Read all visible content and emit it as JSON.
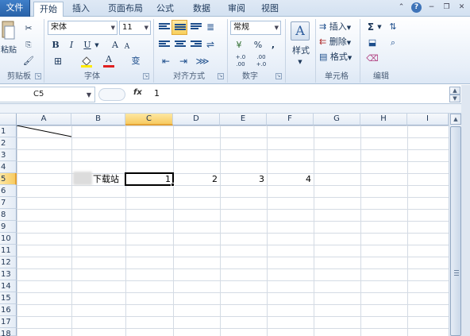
{
  "tabs": [
    "文件",
    "开始",
    "插入",
    "页面布局",
    "公式",
    "数据",
    "审阅",
    "视图"
  ],
  "active_tab": "开始",
  "clipboard": {
    "paste_label": "粘贴",
    "group_label": "剪贴板"
  },
  "font": {
    "font_name": "宋体",
    "font_size": "11",
    "group_label": "字体",
    "bold": "B",
    "italic": "I",
    "underline": "U",
    "grow": "A",
    "shrink": "A",
    "phonetic": "变"
  },
  "alignment": {
    "group_label": "对齐方式"
  },
  "number": {
    "format": "常规",
    "group_label": "数字",
    "currency": "¥",
    "percent": "%",
    "comma": ",",
    "inc_decimal": "+.0 .00",
    "dec_decimal": ".00 +.0"
  },
  "styles": {
    "label": "样式",
    "icon_letter": "A"
  },
  "cells": {
    "insert": "插入",
    "delete": "删除",
    "format": "格式",
    "group_label": "单元格"
  },
  "editing": {
    "group_label": "编辑",
    "sum": "Σ"
  },
  "formula_bar": {
    "name_box": "C5",
    "fx": "fx",
    "value": "1"
  },
  "columns": [
    "A",
    "B",
    "C",
    "D",
    "E",
    "F",
    "G",
    "H",
    "I"
  ],
  "selected_column": "C",
  "rows": [
    "1",
    "2",
    "3",
    "4",
    "5",
    "6",
    "7",
    "8",
    "9",
    "10",
    "11",
    "12",
    "13",
    "14",
    "15",
    "16",
    "17",
    "18"
  ],
  "selected_row": "5",
  "cell_values": {
    "B5": "下载站",
    "C5": "1",
    "D5": "2",
    "E5": "3",
    "F5": "4"
  },
  "colors": {
    "accent": "#2a62a8",
    "selection": "#f7cb62",
    "grid": "#d4dbe4"
  }
}
